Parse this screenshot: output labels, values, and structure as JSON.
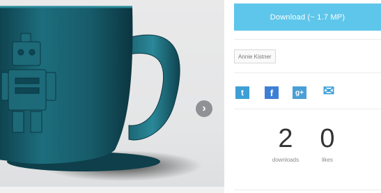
{
  "viewer": {
    "next_arrow_glyph": "›",
    "accent_color": "#1e6a78"
  },
  "panel": {
    "download_label": "Download (~ 1.7 MP)",
    "tag_label": "Annie Kistner",
    "share_icons": [
      "twitter-icon",
      "facebook-icon",
      "google-plus-icon",
      "mail-icon"
    ],
    "share_glyphs": {
      "twitter": "t",
      "facebook": "f",
      "google_plus": "g+",
      "mail": "✉"
    },
    "stats": [
      {
        "value": "2",
        "label": "downloads"
      },
      {
        "value": "0",
        "label": "likes"
      }
    ],
    "colors": {
      "download_button": "#5ec6ea",
      "share_blue": "#3d9fd6"
    }
  }
}
